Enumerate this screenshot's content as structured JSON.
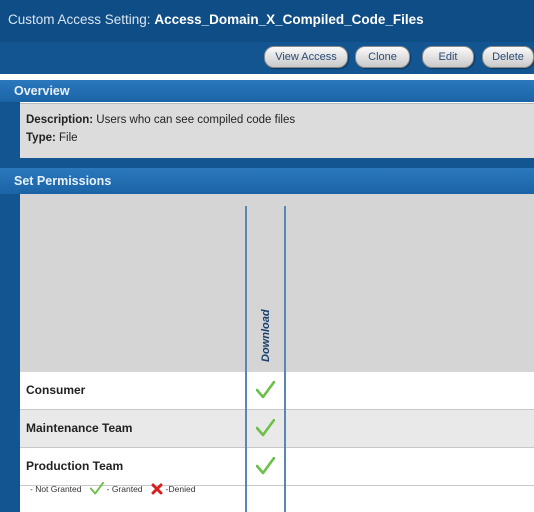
{
  "header": {
    "title_prefix": "Custom Access Setting:",
    "title_name": "Access_Domain_X_Compiled_Code_Files"
  },
  "toolbar": {
    "view_access": "View Access",
    "clone": "Clone",
    "edit": "Edit",
    "delete": "Delete"
  },
  "overview": {
    "heading": "Overview",
    "description_label": "Description:",
    "description_value": "Users who can see compiled code files",
    "type_label": "Type:",
    "type_value": "File"
  },
  "permissions": {
    "heading": "Set Permissions",
    "columns": [
      "Download"
    ],
    "rows": [
      {
        "label": "Consumer",
        "download": "granted"
      },
      {
        "label": "Maintenance Team",
        "download": "granted"
      },
      {
        "label": "Production Team",
        "download": "granted"
      }
    ]
  },
  "legend": {
    "not_granted": "- Not Granted",
    "granted": "- Granted",
    "denied": "-Denied"
  },
  "colors": {
    "header_blue": "#0f4d86",
    "section_blue": "#1a64a6",
    "granted_green": "#6cc04a",
    "denied_red": "#d42020"
  },
  "icons": {
    "granted": "checkmark-icon",
    "denied": "x-mark-icon"
  }
}
